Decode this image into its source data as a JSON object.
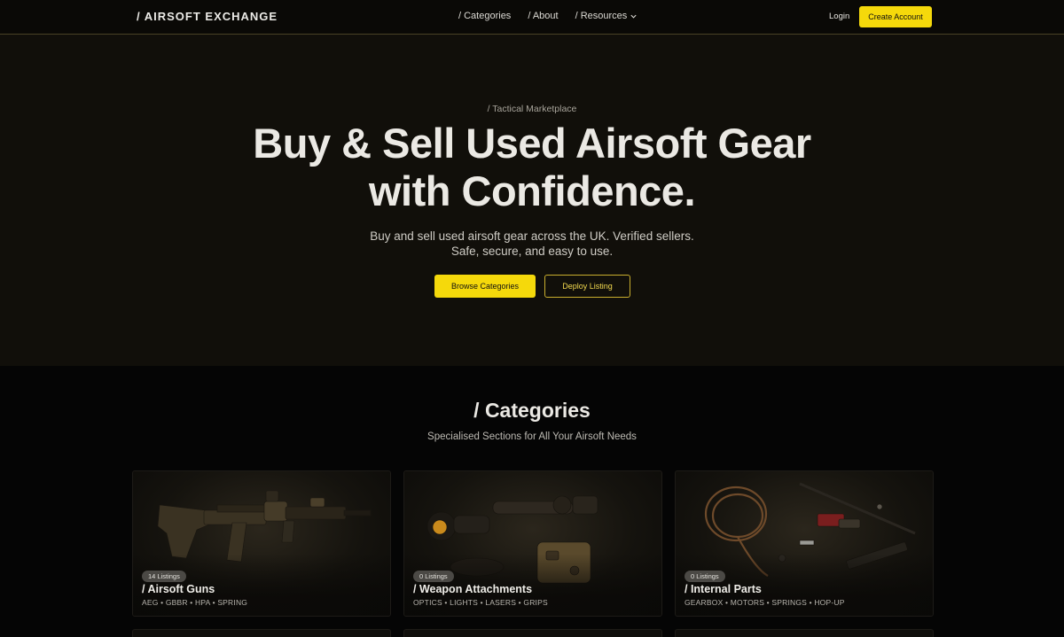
{
  "nav": {
    "logo": "/ AIRSOFT EXCHANGE",
    "links": [
      {
        "label": "/ Categories"
      },
      {
        "label": "/ About"
      },
      {
        "label": "/ Resources"
      }
    ],
    "login_label": "Login",
    "create_account_label": "Create Account"
  },
  "hero": {
    "eyebrow": "/ Tactical Marketplace",
    "title_line1": "Buy & Sell Used Airsoft Gear",
    "title_line2": "with Confidence.",
    "subtitle": "Buy and sell used airsoft gear across the UK. Verified sellers. Safe, secure, and easy to use.",
    "browse_label": "Browse Categories",
    "deploy_label": "Deploy Listing"
  },
  "categories": {
    "title": "/ Categories",
    "subtitle": "Specialised Sections for All Your Airsoft Needs",
    "cards": [
      {
        "badge": "14 Listings",
        "title": "/ Airsoft Guns",
        "tags": "AEG • GBBR • HPA • SPRING"
      },
      {
        "badge": "0 Listings",
        "title": "/ Weapon Attachments",
        "tags": "OPTICS • LIGHTS • LASERS • GRIPS"
      },
      {
        "badge": "0 Listings",
        "title": "/ Internal Parts",
        "tags": "GEARBOX • MOTORS • SPRINGS • HOP-UP"
      }
    ]
  },
  "colors": {
    "accent": "#f5d90b",
    "background": "#050505",
    "hero_background": "#110f0a"
  }
}
